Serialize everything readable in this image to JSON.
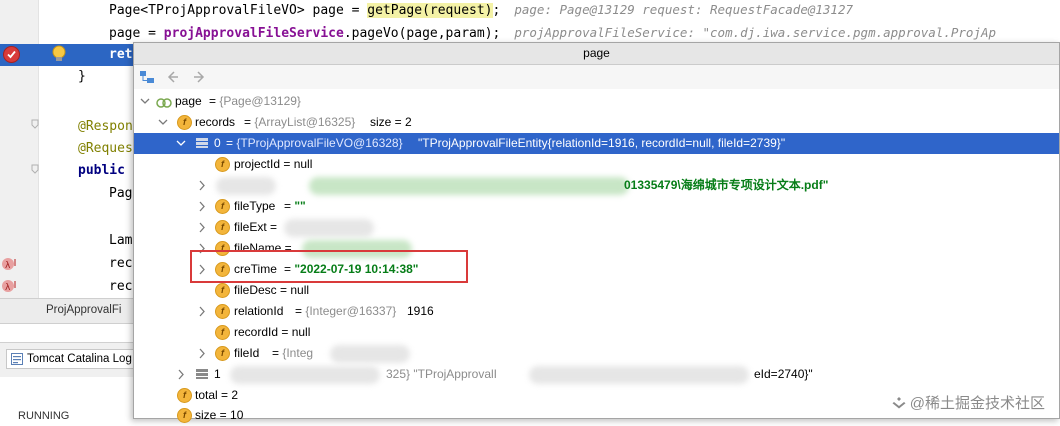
{
  "editor": {
    "line1_prefix": "Page<TProjApprovalFileVO> page = ",
    "line1_method": "getPage(request)",
    "line1_suffix": ";",
    "line1_hint": "page: Page@13129  request: RequestFacade@13127",
    "line2_prefix": "page = ",
    "line2_service": "projApprovalFileService",
    "line2_suffix": ".pageVo(page,param);",
    "line2_hint": "projApprovalFileService: \"com.dj.iwa.service.pgm.approval.ProjAp",
    "line3": "ret",
    "line4": "}",
    "line5": "@Respon",
    "line6": "@Reques",
    "line7_kw": "public",
    "line8": "Pag",
    "line9": "Lam",
    "line10": "rec",
    "line11": "rec",
    "bottom_tab": "ProjApprovalFi",
    "catalina_tab": "Tomcat Catalina Log",
    "running": "RUNNING"
  },
  "popup": {
    "title": "page",
    "tree": {
      "page_name": "page",
      "page_type": "{Page@13129}",
      "records_name": "records",
      "records_type": "{ArrayList@16325}",
      "records_size": "size = 2",
      "item0_name": "0",
      "item0_type": "{TProjApprovalFileVO@16328}",
      "item0_value": "\"TProjApprovalFileEntity{relationId=1916, recordId=null, fileId=2739}\"",
      "projectId": "projectId = null",
      "filepath_tail": "01335479\\海绵城市专项设计文本.pdf\"",
      "fileType_name": "fileType",
      "fileType_value": "\"\"",
      "fileExt": "fileExt =",
      "fileName": "fileName =",
      "creTime_name": "creTime",
      "creTime_value": "\"2022-07-19 10:14:38\"",
      "fileDesc": "fileDesc = null",
      "relationId_name": "relationId",
      "relationId_type": "{Integer@16337}",
      "relationId_value": "1916",
      "recordId": "recordId = null",
      "fileId_name": "fileId",
      "fileId_type": "{Integ",
      "item1_name": "1",
      "item1_mid": "325} \"TProjApprovalI",
      "item1_tail": "eId=2740}\"",
      "total": "total = 2",
      "size": "size = 10"
    }
  },
  "watermark": "@稀土掘金技术社区",
  "colors": {
    "selection": "#2f65ca",
    "string_value": "#067d17",
    "highlight_box": "#d93a3a",
    "field_icon": "#f3b53b"
  }
}
